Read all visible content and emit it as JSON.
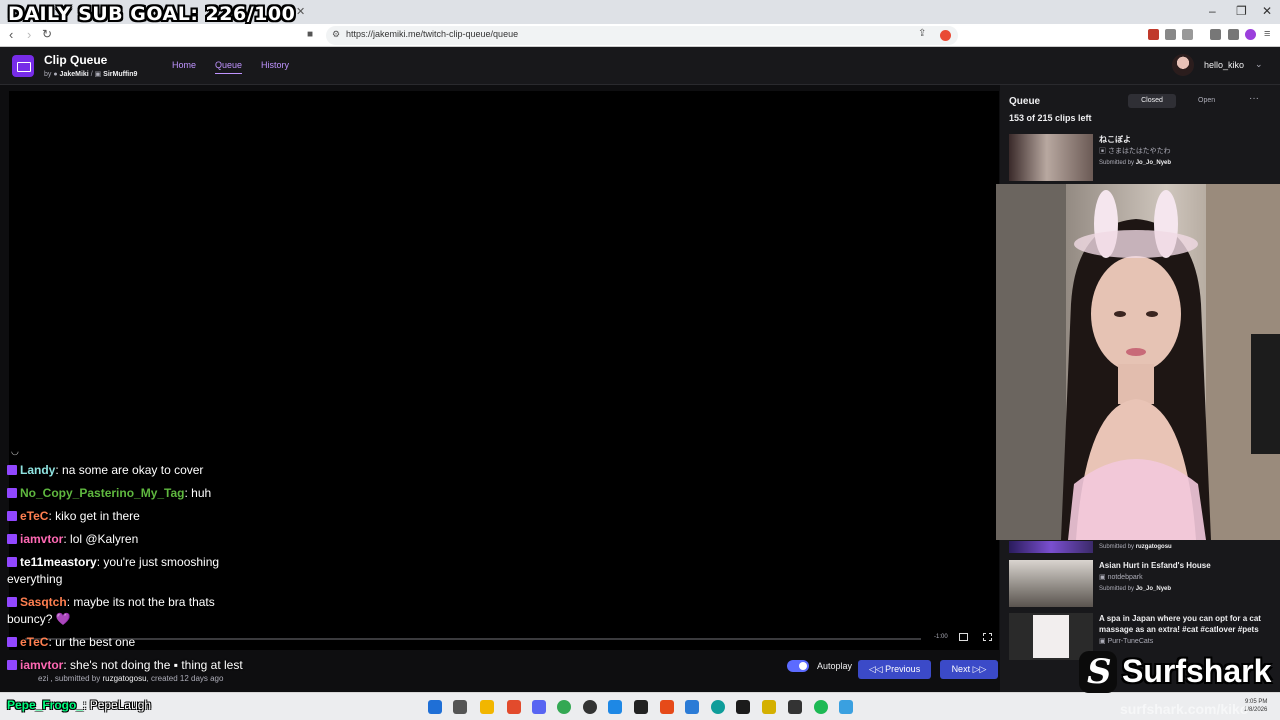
{
  "overlay": {
    "daily_goal": "DAILY SUB GOAL: 226/100"
  },
  "browser": {
    "url": "https://jakemiki.me/twitch-clip-queue/queue"
  },
  "app": {
    "title": "Clip Queue",
    "by_prefix": "by",
    "author1": "JakeMiki",
    "separator": "/",
    "author2": "SirMuffin9",
    "nav": {
      "home": "Home",
      "queue": "Queue",
      "history": "History"
    },
    "username": "hello_kiko"
  },
  "player": {
    "time": "-1:00",
    "clip_meta_submitter": "ruzgatogosu",
    "clip_meta_prefix": "ezi , submitted by",
    "clip_meta_suffix": ", created 12 days ago",
    "autoplay_label": "Autoplay",
    "previous_label": "Previous",
    "next_label": "Next"
  },
  "chat": [
    {
      "nick": "Landy",
      "color": "#8fe3e0",
      "text": "na some are okay to cover"
    },
    {
      "nick": "No_Copy_Pasterino_My_Tag",
      "color": "#5fb83f",
      "text": "huh"
    },
    {
      "nick": "eTeC",
      "color": "#ff7f50",
      "text": "kiko get in there"
    },
    {
      "nick": "iamvtor",
      "color": "#ff69b4",
      "text": "lol @Kalyren"
    },
    {
      "nick": "te11meastory",
      "color": "#ffffff",
      "text": "you're just smooshing everything"
    },
    {
      "nick": "Sasqtch",
      "color": "#ff7f50",
      "text": "maybe its not the bra thats bouncy? 💜"
    },
    {
      "nick": "eTeC",
      "color": "#ff7f50",
      "text": "ur the best one"
    },
    {
      "nick": "iamvtor",
      "color": "#ff69b4",
      "text": "she's not doing the ▪ thing at lest"
    }
  ],
  "bottom_chat": {
    "nick": "Pepe_Frogo_",
    "text": "PepeLaugh"
  },
  "queue": {
    "title": "Queue",
    "count": "153 of 215 clips left",
    "closed_label": "Closed",
    "open_label": "Open",
    "more_label": "···",
    "submitted_by": "Submitted by",
    "items": [
      {
        "title": "ねこぼよ",
        "channel": "さまはたはたやたわ",
        "submitter": "Jo_Jo_Nyeb"
      },
      {
        "title": "",
        "channel": "",
        "submitter": "ruzgatogosu"
      },
      {
        "title": "Asian Hurt in Esfand's House",
        "channel": "notdebpark",
        "submitter": "Jo_Jo_Nyeb"
      },
      {
        "title": "A spa in Japan where you can opt for a cat massage as an extra! #cat #catlover #pets",
        "channel": "Purr-TuneCats",
        "submitter": "ruzgatogosu"
      }
    ]
  },
  "watermark": {
    "brand": "Surfshark",
    "url": "surfshark.com/kiko"
  },
  "taskbar": {
    "time": "9:05 PM",
    "date": "1/8/2026"
  },
  "colors": {
    "accent": "#772ce8",
    "link": "#bf94ff",
    "button": "#3b4ac8",
    "toggle": "#5c6bff"
  }
}
